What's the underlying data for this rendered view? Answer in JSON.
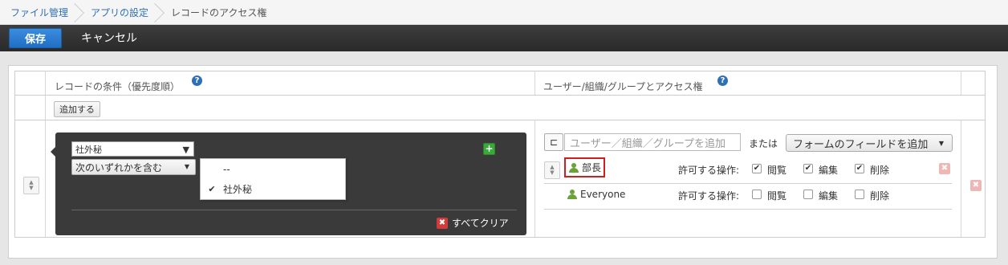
{
  "breadcrumb": {
    "item1": "ファイル管理",
    "item2": "アプリの設定",
    "item3": "レコードのアクセス権"
  },
  "toolbar": {
    "save_label": "保存",
    "cancel_label": "キャンセル"
  },
  "table": {
    "header_conditions": "レコードの条件（優先度順）",
    "header_access": "ユーザー/組織/グループとアクセス権",
    "help_glyph": "?",
    "add_button": "追加する"
  },
  "condition": {
    "field_select": "社外秘",
    "operator_select": "次のいずれかを含む",
    "add_glyph": "+",
    "clear_all": "すべてクリア",
    "clear_glyph": "✖",
    "dropdown_options": [
      {
        "label": "--",
        "checked": false
      },
      {
        "label": "社外秘",
        "checked": true
      }
    ]
  },
  "access": {
    "input_placeholder": "ユーザー／組織／グループを追加",
    "or_text": "または",
    "field_button": "フォームのフィールドを追加",
    "entries": [
      {
        "name": "部長",
        "perm_label": "許可する操作:",
        "view": "閲覧",
        "edit": "編集",
        "delete": "削除",
        "view_checked": true,
        "edit_checked": true,
        "delete_checked": true
      },
      {
        "name": "Everyone",
        "perm_label": "許可する操作:",
        "view": "閲覧",
        "edit": "編集",
        "delete": "削除",
        "view_checked": false,
        "edit_checked": false,
        "delete_checked": false
      }
    ]
  },
  "colors": {
    "accent": "#2f6fb5",
    "save": "#1f6fc5",
    "highlight": "#d01e1e",
    "user_icon": "#6aa23a"
  }
}
